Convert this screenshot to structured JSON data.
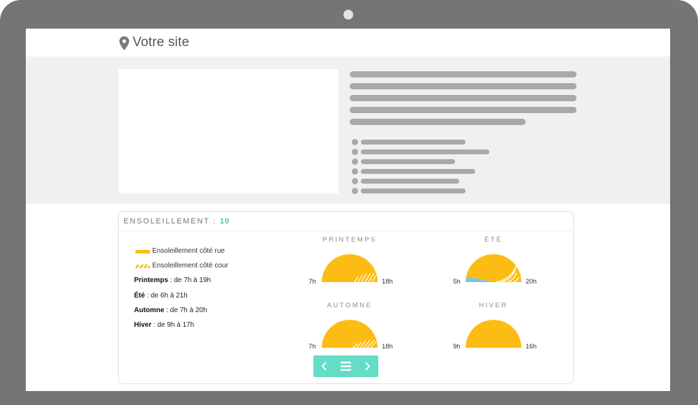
{
  "header": {
    "title": "Votre site",
    "icon": "location-pin-icon"
  },
  "colors": {
    "sun": "#fbbd14",
    "accent": "#3cc9b0",
    "nav": "#64dcc6",
    "shade": "#7dc3e8"
  },
  "sunlight": {
    "title": "ENSOLEILLEMENT :",
    "score": "10",
    "legend": {
      "street": "Ensoleillement côté rue",
      "courtyard": "Ensoleillement côté cour"
    },
    "seasons": [
      {
        "name": "Printemps",
        "label": "PRINTEMPS",
        "detail": " : de 7h à 19h",
        "start": "7h",
        "end": "18h"
      },
      {
        "name": "Été",
        "label": "ÉTÉ",
        "detail": " : de 6h à 21h",
        "start": "5h",
        "end": "20h"
      },
      {
        "name": "Automne",
        "label": "AUTOMNE",
        "detail": " : de 7h à 20h",
        "start": "7h",
        "end": "18h"
      },
      {
        "name": "Hiver",
        "label": "HIVER",
        "detail": " : de 9h à 17h",
        "start": "9h",
        "end": "16h"
      }
    ]
  },
  "nav": {
    "prev_icon": "chevron-left-icon",
    "menu_icon": "menu-icon",
    "next_icon": "chevron-right-icon"
  }
}
